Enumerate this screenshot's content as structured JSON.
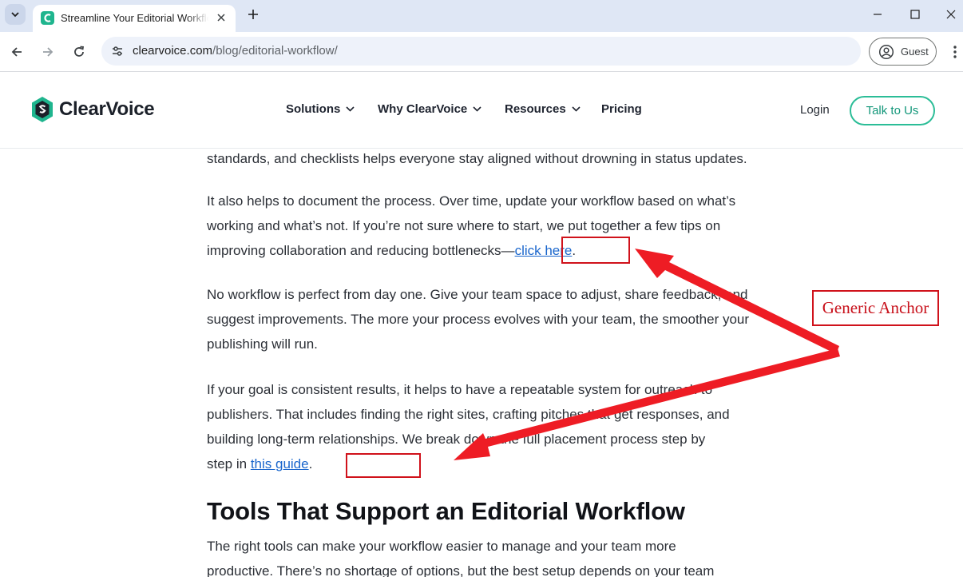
{
  "browser": {
    "tab_title": "Streamline Your Editorial Workflow",
    "url_domain": "clearvoice.com",
    "url_path": "/blog/editorial-workflow/",
    "profile_label": "Guest"
  },
  "site": {
    "logo_text": "ClearVoice",
    "nav": [
      "Solutions",
      "Why ClearVoice",
      "Resources",
      "Pricing"
    ],
    "login_label": "Login",
    "cta_label": "Talk to Us",
    "brand_color": "#2bbd97"
  },
  "article": {
    "p0": "standards, and checklists helps everyone stay aligned without drowning in status updates.",
    "p1_text": "It also helps to document the process. Over time, update your workflow based on what’s working and what’s not. If you’re not sure where to start, we put together a few tips on improving collaboration and reducing bottlenecks—",
    "p1_link": "click here",
    "p1_end": ".",
    "p2": "No workflow is perfect from day one. Give your team space to adjust, share feedback, and suggest improvements. The more your process evolves with your team, the smoother your publishing will run.",
    "p3_text": "If your goal is consistent results, it helps to have a repeatable system for outreach to publishers. That includes finding the right sites, crafting pitches that get responses, and building long-term relationships. We break down the full placement process step by step in ",
    "p3_link": "this guide",
    "p3_end": ".",
    "heading": "Tools That Support an Editorial Workflow",
    "p4": "The right tools can make your workflow easier to manage and your team more productive. There’s no shortage of options, but the best setup depends on your team"
  },
  "annotation": {
    "label": "Generic Anchor",
    "color": "#d0121b"
  }
}
